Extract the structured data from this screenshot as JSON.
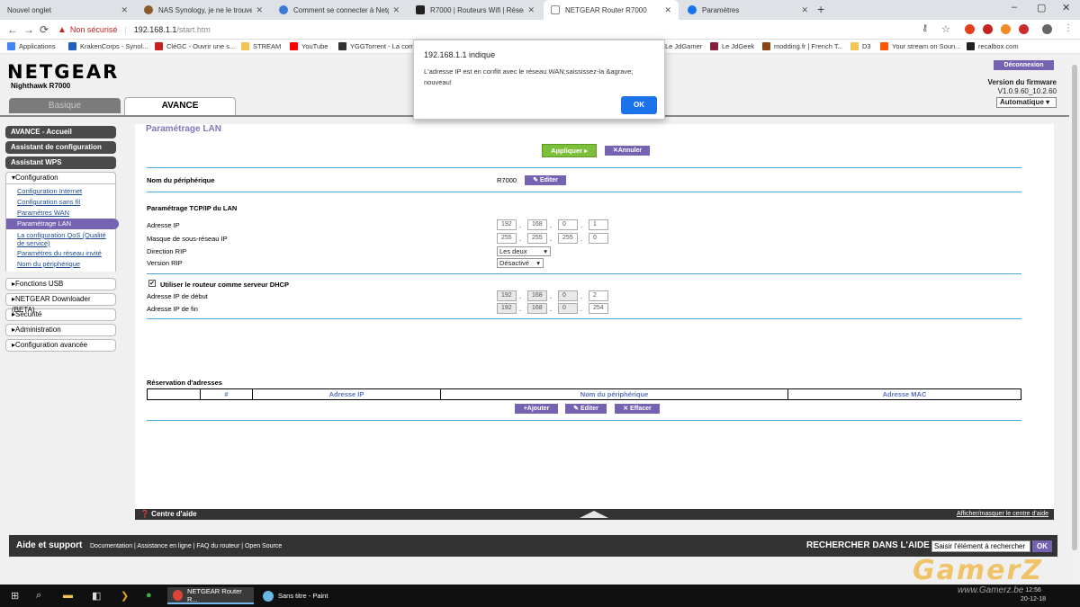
{
  "browser": {
    "tabs": [
      {
        "title": "Nouvel onglet",
        "color": "#dee1e6"
      },
      {
        "title": "NAS Synology, je ne le trouve pl...",
        "color": "#8b5a2b"
      },
      {
        "title": "Comment se connecter à Netgea...",
        "color": "#3b7bd4"
      },
      {
        "title": "R7000 | Routeurs Wifi | Réseau | ...",
        "color": "#222222"
      },
      {
        "title": "NETGEAR Router R7000",
        "color": "#888888"
      },
      {
        "title": "Paramètres",
        "color": "#1a73e8"
      }
    ],
    "new_tab": "+",
    "window_controls": [
      "–",
      "▢",
      "✕"
    ],
    "address": {
      "warning_icon": "▲",
      "not_secure": "Non sécurisé",
      "separator": "|",
      "host": "192.168.1.1",
      "path": "/start.htm"
    },
    "bookmarks": [
      "Applications",
      "KrakenCorps - Synol...",
      "CléGC - Ouvrir une s...",
      "STREAM",
      "YouTube",
      "YGGTorrent - La com...",
      "Le JdGamer",
      "Le JdGeek",
      "modding.fr | French T...",
      "D3",
      "Your stream on Soun...",
      "recalbox.com"
    ]
  },
  "router": {
    "brand": "NETGEAR",
    "model": "Nighthawk R7000",
    "tab_basic": "Basique",
    "tab_advanced": "AVANCE",
    "logout": "Déconnexion",
    "firmware_title": "Version du firmware",
    "firmware_version": "V1.0.9.60_10.2.60",
    "update_mode": "Automatique ▾"
  },
  "sidebar": {
    "top": [
      "AVANCE - Accueil",
      "Assistant de configuration",
      "Assistant WPS"
    ],
    "config_header": "▾Configuration",
    "config_items": [
      "Configuration Internet",
      "Configuration sans fil",
      "Paramètres WAN",
      "Paramétrage LAN",
      "La configuration QoS (Qualité de service)",
      "Paramètres du réseau invité",
      "Nom du périphérique"
    ],
    "collapsed": [
      "▸Fonctions USB",
      "▸NETGEAR Downloader (BETA)",
      "▸Sécurité",
      "▸Administration",
      "▸Configuration avancée"
    ]
  },
  "content": {
    "title": "Paramétrage LAN",
    "apply": "Appliquer ▸",
    "cancel": "✕Annuler",
    "device_name_label": "Nom du périphérique",
    "device_name": "R7000",
    "edit": "✎ Editer",
    "tcpip_title": "Paramétrage TCP/IP du LAN",
    "ip_label": "Adresse IP",
    "ip": [
      "192",
      "168",
      "0",
      "1"
    ],
    "mask_label": "Masque de sous-réseau IP",
    "mask": [
      "255",
      "255",
      "255",
      "0"
    ],
    "rip_dir_label": "Direction RIP",
    "rip_dir": "Les deux",
    "rip_ver_label": "Version RIP",
    "rip_ver": "Désactivé",
    "dhcp_check": "✔",
    "dhcp_label": "Utiliser le routeur comme serveur DHCP",
    "start_label": "Adresse IP de début",
    "start_ip": [
      "192",
      "168",
      "0",
      "2"
    ],
    "end_label": "Adresse IP de fin",
    "end_ip": [
      "192",
      "168",
      "0",
      "254"
    ],
    "reservation_title": "Réservation d'adresses",
    "table_headers": [
      "",
      "#",
      "Adresse IP",
      "Nom du périphérique",
      "Adresse MAC"
    ],
    "add": "+Ajouter",
    "edit2": "✎ Editer",
    "delete": "✕ Effacer",
    "help_center": "❓ Centre d'aide",
    "help_toggle": "Afficher/masquer le centre d'aide"
  },
  "footer": {
    "title": "Aide et support",
    "links": "Documentation | Assistance en ligne | FAQ du routeur | Open Source",
    "search_label": "RECHERCHER DANS L'AIDE",
    "search_value": "Saisir l'élément à rechercher",
    "ok": "OK"
  },
  "dialog": {
    "title": "192.168.1.1 indique",
    "message": "L'adresse IP est en conflit avec le réseau WAN;saississez-la &agrave; nouveau!",
    "ok": "OK"
  },
  "taskbar": {
    "apps": [
      "NETGEAR Router R...",
      "Sans titre - Paint"
    ],
    "time": "12:56",
    "date": "20-12-18"
  },
  "watermark": "GamerZ",
  "watermark_url": "www.Gamerz.be",
  "colors": {
    "accent": "#7563b1",
    "apply_green": "#7dbf3a",
    "rule_blue": "#4aa3d9",
    "dialog_ok": "#1a73e8"
  }
}
